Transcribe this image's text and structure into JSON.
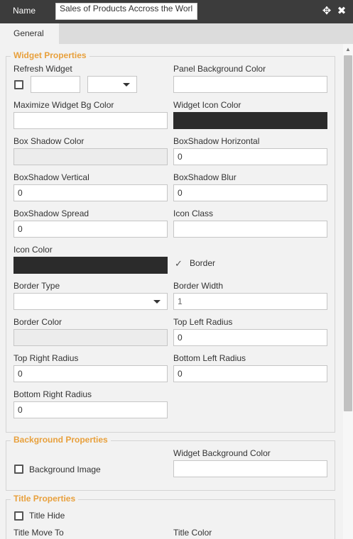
{
  "header": {
    "name_label": "Name",
    "name_value": "Sales of Products Accross the Worl",
    "move_icon": "move-icon",
    "close_icon": "close-icon"
  },
  "tabs": [
    {
      "label": "General",
      "active": true
    }
  ],
  "widget_properties": {
    "legend": "Widget Properties",
    "refresh_widget": {
      "label": "Refresh Widget",
      "value": "",
      "select_value": ""
    },
    "panel_bg_color": {
      "label": "Panel Background Color",
      "value": ""
    },
    "maximize_bg_color": {
      "label": "Maximize Widget Bg Color",
      "value": ""
    },
    "widget_icon_color": {
      "label": "Widget Icon Color",
      "color": "#2b2b2b"
    },
    "box_shadow_color": {
      "label": "Box Shadow Color",
      "value": ""
    },
    "boxshadow_horizontal": {
      "label": "BoxShadow Horizontal",
      "value": "0"
    },
    "boxshadow_vertical": {
      "label": "BoxShadow Vertical",
      "value": "0"
    },
    "boxshadow_blur": {
      "label": "BoxShadow Blur",
      "value": "0"
    },
    "boxshadow_spread": {
      "label": "BoxShadow Spread",
      "value": "0"
    },
    "icon_class": {
      "label": "Icon Class",
      "value": ""
    },
    "icon_color": {
      "label": "Icon Color",
      "color": "#2b2b2b"
    },
    "border": {
      "label": "Border",
      "checked": true
    },
    "border_type": {
      "label": "Border Type",
      "value": ""
    },
    "border_width": {
      "label": "Border Width",
      "value": "1"
    },
    "border_color": {
      "label": "Border Color",
      "value": ""
    },
    "top_left_radius": {
      "label": "Top Left Radius",
      "value": "0"
    },
    "top_right_radius": {
      "label": "Top Right Radius",
      "value": "0"
    },
    "bottom_left_radius": {
      "label": "Bottom Left Radius",
      "value": "0"
    },
    "bottom_right_radius": {
      "label": "Bottom Right Radius",
      "value": "0"
    }
  },
  "background_properties": {
    "legend": "Background Properties",
    "background_image": {
      "label": "Background Image",
      "checked": false
    },
    "widget_bg_color": {
      "label": "Widget Background Color",
      "value": ""
    }
  },
  "title_properties": {
    "legend": "Title Properties",
    "title_hide": {
      "label": "Title Hide",
      "checked": false
    },
    "title_move_to": {
      "label": "Title Move To"
    },
    "title_color": {
      "label": "Title Color"
    }
  },
  "colors": {
    "accent": "#e8a03c",
    "header_bg": "#3c3c3c"
  }
}
